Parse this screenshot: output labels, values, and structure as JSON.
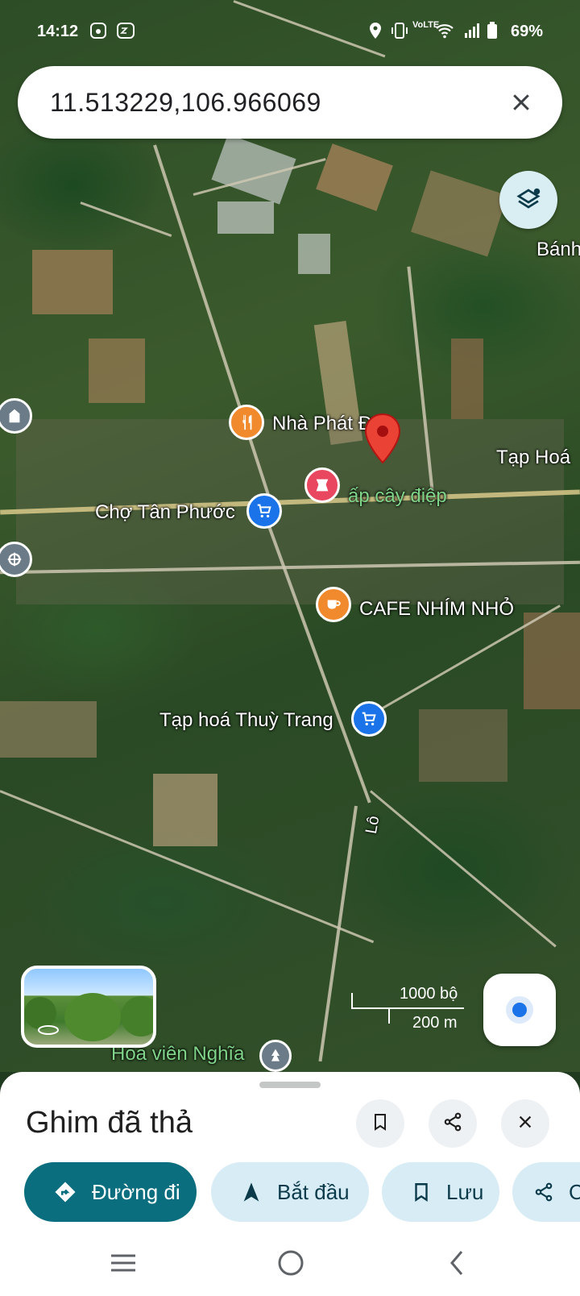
{
  "status_bar": {
    "time": "14:12",
    "battery": "69%",
    "network": "VoLTE"
  },
  "search": {
    "value": "11.513229,106.966069",
    "clear_icon": "close-icon"
  },
  "map": {
    "labels": {
      "nha_phat": "Nhà Phát Đ",
      "tap_hoa_right": "Tạp Hoá",
      "cho_tan_phuoc": "Chợ Tân Phước",
      "ap_cay_diep": "ấp cây điệp",
      "cafe": "CAFE NHÍM NHỎ",
      "tap_hoa_thuy_trang": "Tạp hoá Thuỳ Trang",
      "banh": "Bánh",
      "lo": "Lô",
      "hoa_vien": "Hoa viên Nghĩa"
    },
    "scale": {
      "feet": "1000 bộ",
      "meters": "200 m"
    }
  },
  "sheet": {
    "title": "Ghim đã thả",
    "actions": {
      "directions": "Đường đi",
      "start": "Bắt đầu",
      "save": "Lưu",
      "share_partial": "C"
    }
  },
  "colors": {
    "primary": "#0b6e7e",
    "chip": "#d7ecf5",
    "pin": "#ea4335"
  }
}
